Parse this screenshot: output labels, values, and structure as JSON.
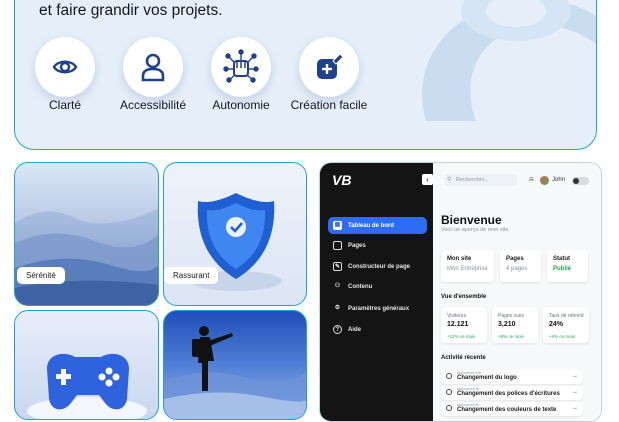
{
  "hero": {
    "text": "et faire grandir vos projets."
  },
  "features": [
    {
      "label": "Clarté",
      "icon": "eye-icon"
    },
    {
      "label": "Accessibilité",
      "icon": "user-icon"
    },
    {
      "label": "Autonomie",
      "icon": "fist-network-icon"
    },
    {
      "label": "Création facile",
      "icon": "edit-add-icon"
    }
  ],
  "cards": {
    "serenite": "Sérénité",
    "rassurant": "Rassurant"
  },
  "dashboard": {
    "logo": "VB",
    "collapse": "‹",
    "search_placeholder": "Rechercher...",
    "user": "John",
    "nav": [
      {
        "label": "Tableau de bord",
        "active": true,
        "icon": "grid-icon"
      },
      {
        "label": "Pages",
        "active": false,
        "icon": "page-icon"
      },
      {
        "label": "Constructeur de page",
        "active": false,
        "icon": "builder-icon"
      },
      {
        "label": "Contenu",
        "active": false,
        "icon": "content-icon"
      },
      {
        "label": "Paramètres généraux",
        "active": false,
        "icon": "gear-icon"
      },
      {
        "label": "Aide",
        "active": false,
        "icon": "help-icon"
      }
    ],
    "welcome": "Bienvenue",
    "welcome_sub": "Voici un aperçu de mon site.",
    "site_cards": [
      {
        "title": "Mon site",
        "value": "Mon Entreprise"
      },
      {
        "title": "Pages",
        "value": "4 pages"
      },
      {
        "title": "Statut",
        "value": "Publié"
      }
    ],
    "overview_title": "Vue d'ensemble",
    "stats": [
      {
        "label": "Visiteurs",
        "value": "12.121",
        "change": "+12% ce mois"
      },
      {
        "label": "Pages vues",
        "value": "3,210",
        "change": "+8% ce mois"
      },
      {
        "label": "Taux de rebond",
        "value": "24%",
        "change": "+4% ce mois"
      }
    ],
    "activity_title": "Activité récente",
    "activity": [
      {
        "date": "Aujourd'hui 10h",
        "text": "Changement du logo"
      },
      {
        "date": "Aujourd'hui 9h",
        "text": "Changement des polices d'écritures"
      },
      {
        "date": "Aujourd'hui 8h",
        "text": "Changement des couleurs de texte"
      }
    ],
    "arrow": "→"
  }
}
